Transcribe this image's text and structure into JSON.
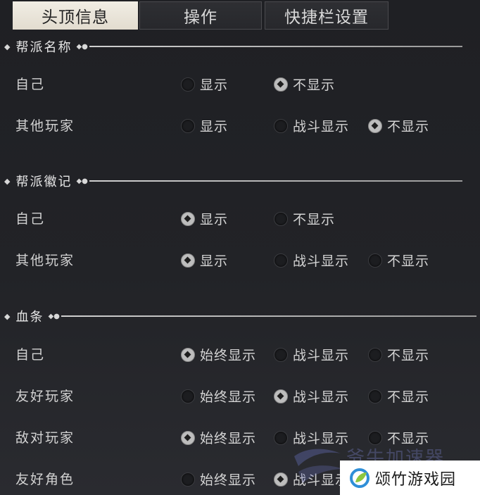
{
  "tabs": [
    {
      "label": "头顶信息",
      "active": true
    },
    {
      "label": "操作",
      "active": false
    },
    {
      "label": "快捷栏设置",
      "active": false
    }
  ],
  "sections": [
    {
      "title": "帮派名称",
      "rows": [
        {
          "label": "自己",
          "options": [
            "显示",
            "不显示"
          ],
          "selected": "不显示"
        },
        {
          "label": "其他玩家",
          "options": [
            "显示",
            "战斗显示",
            "不显示"
          ],
          "selected": "不显示"
        }
      ]
    },
    {
      "title": "帮派徽记",
      "rows": [
        {
          "label": "自己",
          "options": [
            "显示",
            "不显示"
          ],
          "selected": "显示"
        },
        {
          "label": "其他玩家",
          "options": [
            "显示",
            "战斗显示",
            "不显示"
          ],
          "selected": "显示"
        }
      ]
    },
    {
      "title": "血条",
      "rows": [
        {
          "label": "自己",
          "options": [
            "始终显示",
            "战斗显示",
            "不显示"
          ],
          "selected": "始终显示"
        },
        {
          "label": "友好玩家",
          "options": [
            "始终显示",
            "战斗显示",
            "不显示"
          ],
          "selected": "战斗显示"
        },
        {
          "label": "敌对玩家",
          "options": [
            "始终显示",
            "战斗显示",
            "不显示"
          ],
          "selected": "始终显示"
        },
        {
          "label": "友好角色",
          "options": [
            "始终显示",
            "战斗显示"
          ],
          "selected": "战斗显示"
        }
      ]
    }
  ],
  "watermark": {
    "faded_text": "爷牛加速器",
    "brand_text": "颂竹游戏园"
  },
  "colors": {
    "active_tab": "#ece7dd",
    "background": "#222327",
    "brand_logo_blue": "#2f8fd8",
    "brand_logo_green": "#8cc63f"
  }
}
